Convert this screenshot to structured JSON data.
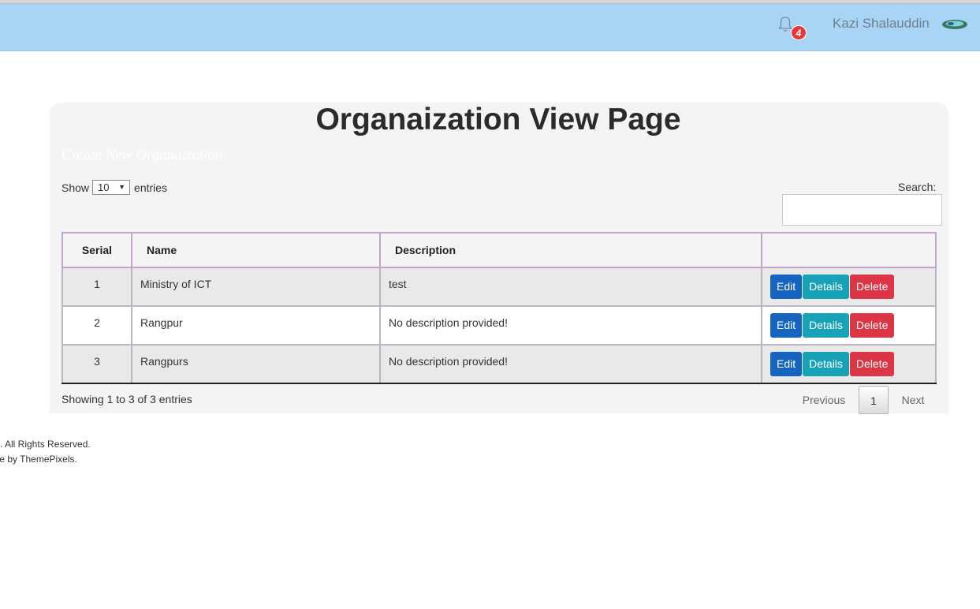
{
  "header": {
    "notification_count": "4",
    "user_name": "Kazi Shalauddin"
  },
  "page": {
    "title": "Organaization View Page",
    "create_link": "Create New Organaization"
  },
  "table_controls": {
    "show_label": "Show",
    "entries_label": "entries",
    "page_length": "10",
    "search_label": "Search:",
    "search_value": ""
  },
  "table": {
    "columns": [
      "Serial",
      "Name",
      "Description",
      ""
    ],
    "rows": [
      {
        "serial": "1",
        "name": "Ministry of ICT",
        "description": "test"
      },
      {
        "serial": "2",
        "name": "Rangpur",
        "description": "No description provided!"
      },
      {
        "serial": "3",
        "name": "Rangpurs",
        "description": "No description provided!"
      }
    ],
    "actions": {
      "edit": "Edit",
      "details": "Details",
      "delete": "Delete"
    }
  },
  "pagination": {
    "info": "Showing 1 to 3 of 3 entries",
    "previous": "Previous",
    "current": "1",
    "next": "Next"
  },
  "footer": {
    "rights": ". All Rights Reserved.",
    "made_by": "ade by ThemePixels."
  },
  "colors": {
    "header_bg": "#a8d5f6",
    "edit": "#1565c0",
    "details": "#17a2b8",
    "delete": "#dc3545",
    "badge": "#e53935"
  }
}
